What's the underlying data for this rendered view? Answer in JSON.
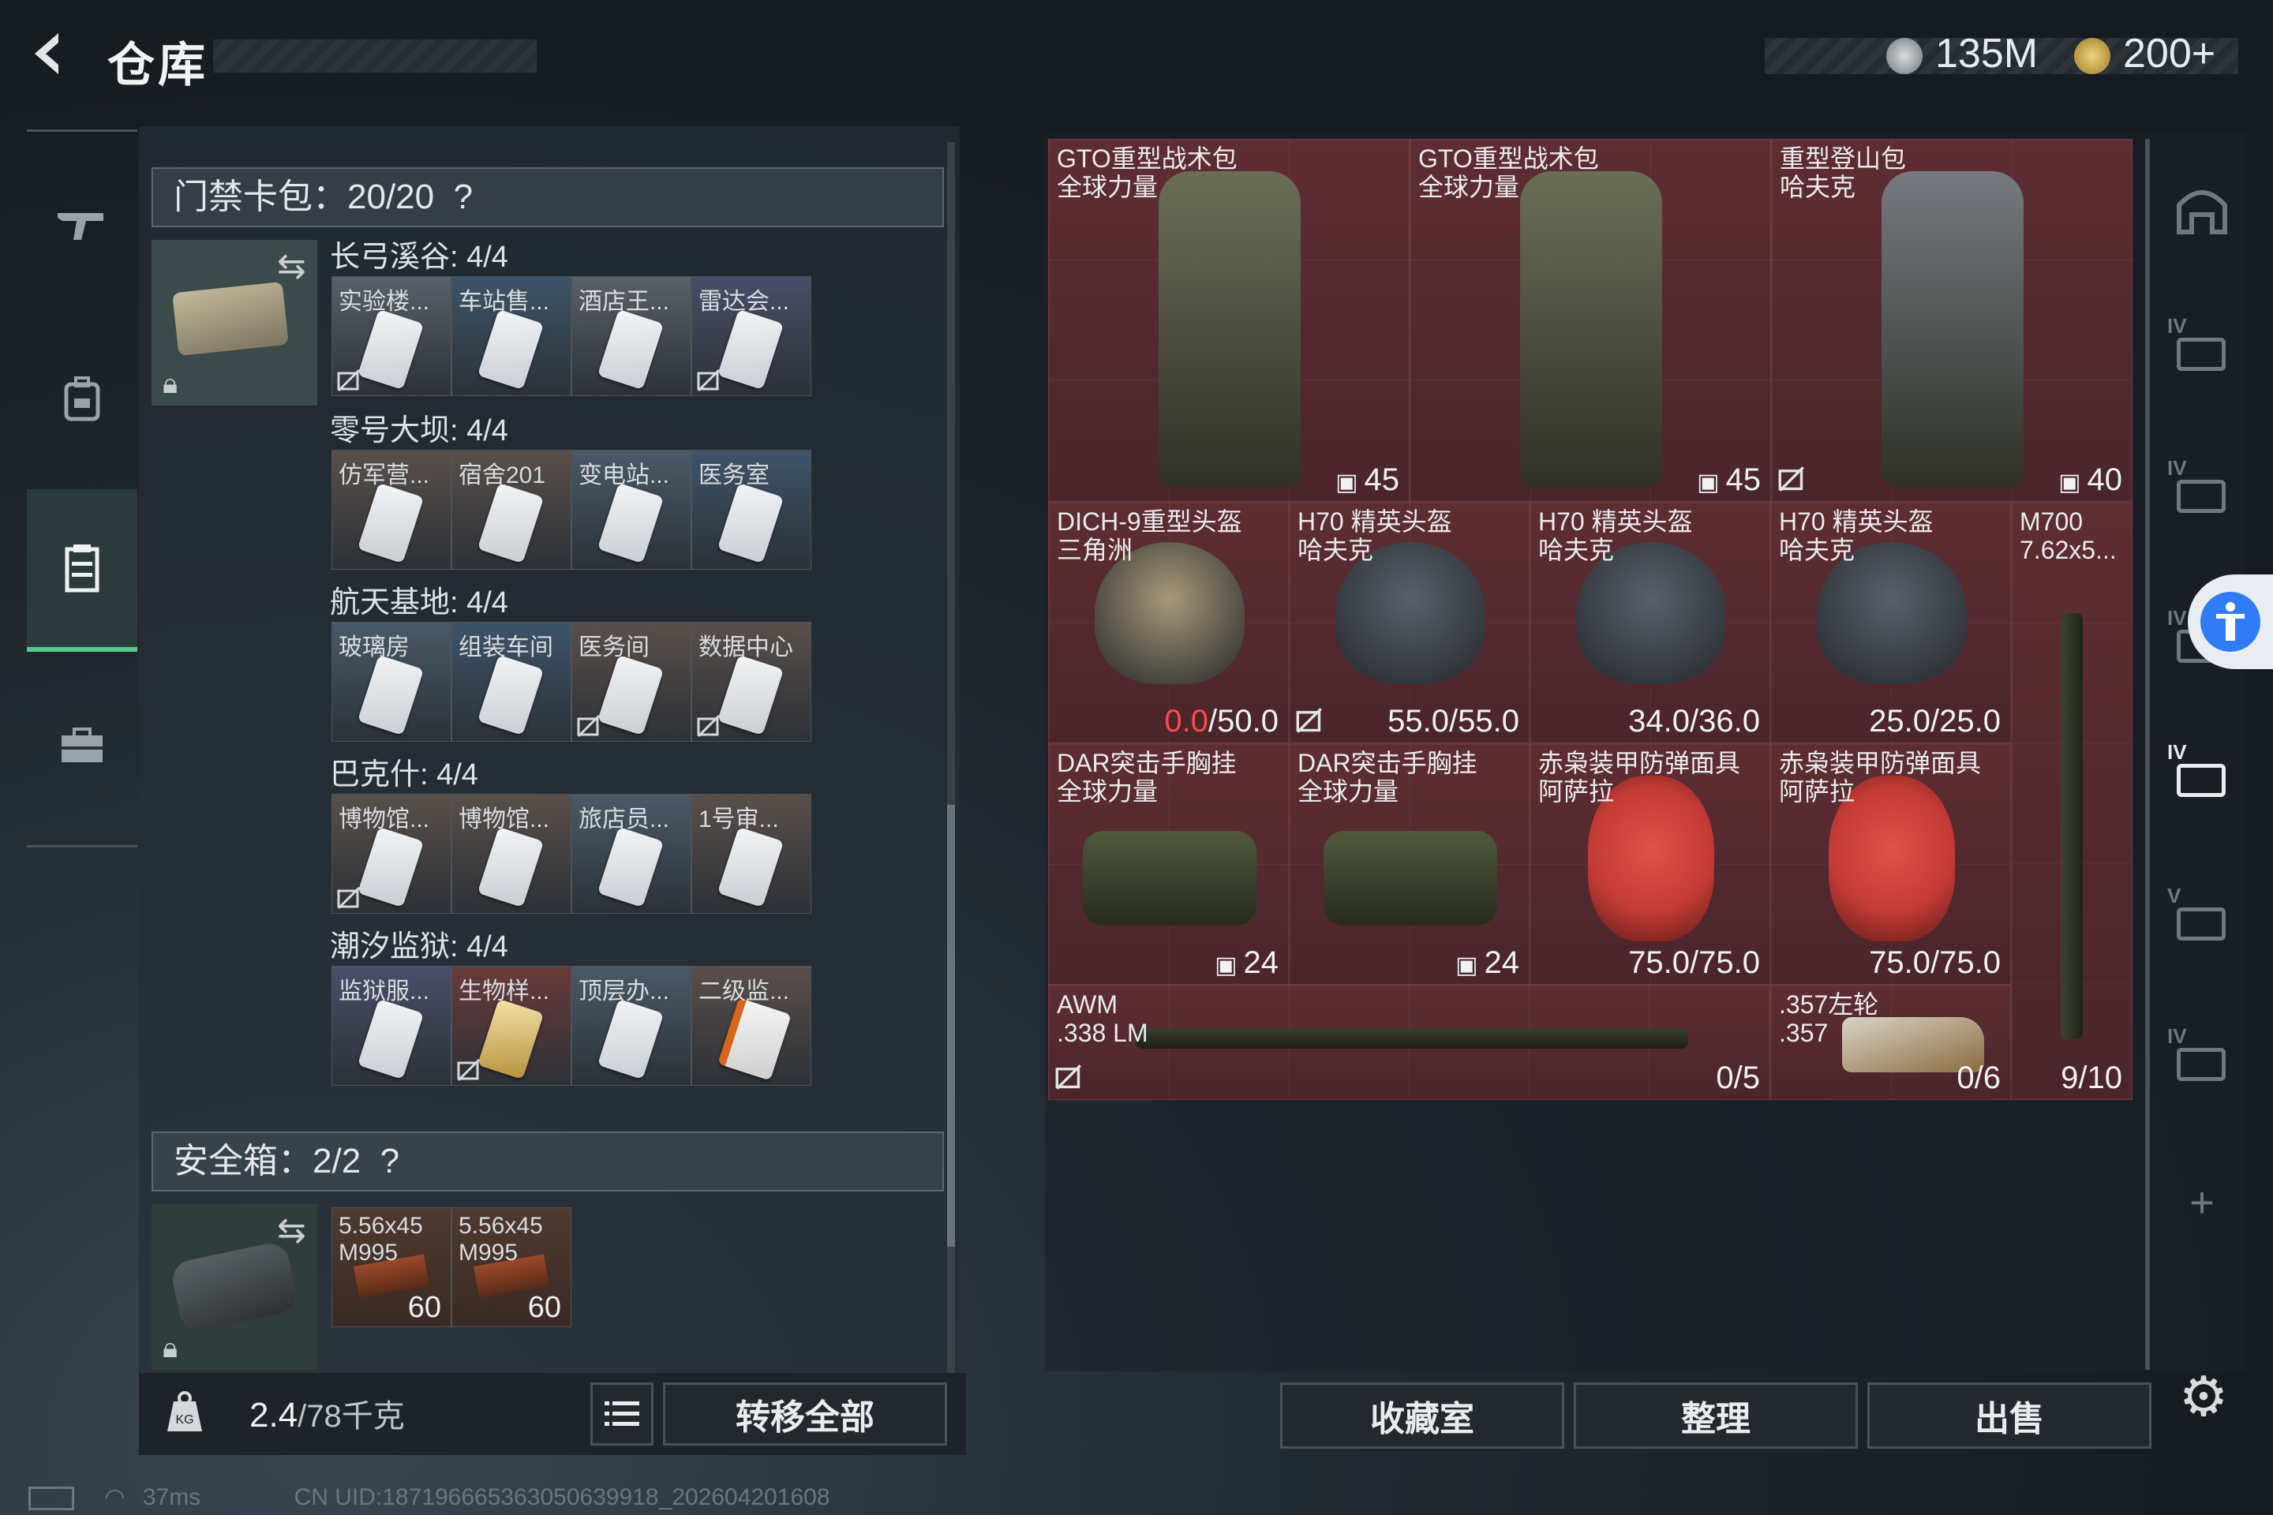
{
  "header": {
    "back_icon": "chevron-left-icon",
    "title": "仓库",
    "currency_1": "135M",
    "currency_2": "200+"
  },
  "left_nav": {
    "items": [
      {
        "name": "weapon-icon"
      },
      {
        "name": "backpack-icon"
      },
      {
        "name": "storage-case-icon",
        "active": true
      },
      {
        "name": "briefcase-icon"
      }
    ]
  },
  "keycard": {
    "header": "门禁卡包：20/20",
    "help": "?",
    "groups": [
      {
        "title": "长弓溪谷: 4/4",
        "items": [
          {
            "label": "实验楼...",
            "locked": true,
            "tint": "#5a6068"
          },
          {
            "label": "车站售...",
            "locked": false,
            "tint": "#3d5568"
          },
          {
            "label": "酒店王...",
            "locked": false,
            "tint": "#5b6068"
          },
          {
            "label": "雷达会...",
            "locked": true,
            "tint": "#4a4e68"
          }
        ]
      },
      {
        "title": "零号大坝: 4/4",
        "items": [
          {
            "label": "仿军营...",
            "locked": false,
            "tint": "#5a4f4a"
          },
          {
            "label": "宿舍201",
            "locked": false,
            "tint": "#5a4f4a"
          },
          {
            "label": "变电站...",
            "locked": false,
            "tint": "#4a5a68"
          },
          {
            "label": "医务室",
            "locked": false,
            "tint": "#3e546a"
          }
        ]
      },
      {
        "title": "航天基地: 4/4",
        "items": [
          {
            "label": "玻璃房",
            "locked": false,
            "tint": "#4a5a68"
          },
          {
            "label": "组装车间",
            "locked": false,
            "tint": "#3e546a"
          },
          {
            "label": "医务间",
            "locked": true,
            "tint": "#5a4f4a"
          },
          {
            "label": "数据中心",
            "locked": true,
            "tint": "#5a4f4a"
          }
        ]
      },
      {
        "title": "巴克什: 4/4",
        "items": [
          {
            "label": "博物馆...",
            "locked": true,
            "tint": "#5a4f4a"
          },
          {
            "label": "博物馆...",
            "locked": false,
            "tint": "#5a4f4a"
          },
          {
            "label": "旅店员...",
            "locked": false,
            "tint": "#4a5a68"
          },
          {
            "label": "1号审...",
            "locked": false,
            "tint": "#5a4f4a"
          }
        ]
      },
      {
        "title": "潮汐监狱: 4/4",
        "items": [
          {
            "label": "监狱服...",
            "locked": false,
            "tint": "#4a4e68"
          },
          {
            "label": "生物样...",
            "locked": true,
            "tint": "#6a3a3a",
            "card": "gold"
          },
          {
            "label": "顶层办...",
            "locked": false,
            "tint": "#4a5a68"
          },
          {
            "label": "二级监...",
            "locked": false,
            "tint": "#5a4f4a",
            "card": "red"
          }
        ]
      }
    ]
  },
  "safebox": {
    "header": "安全箱：2/2",
    "help": "?",
    "items": [
      {
        "label": "5.56x45\nM995",
        "count": "60"
      },
      {
        "label": "5.56x45\nM995",
        "count": "60"
      }
    ]
  },
  "footer_left": {
    "weight_value": "2.4",
    "weight_total": "/78千克",
    "list_icon": "list-icon",
    "transfer_all": "转移全部"
  },
  "grid_items": [
    {
      "name": "GTO重型战术包\n全球力量",
      "stat": "45",
      "stat_icon": "backpack-small-icon",
      "kind": "pack",
      "tint": "#6b6e55"
    },
    {
      "name": "GTO重型战术包\n全球力量",
      "stat": "45",
      "stat_icon": "backpack-small-icon",
      "kind": "pack",
      "tint": "#6b6e55"
    },
    {
      "name": "重型登山包\n哈夫克",
      "stat": "40",
      "stat_icon": "backpack-small-icon",
      "kind": "pack",
      "tint": "#767a80",
      "locked": true
    },
    {
      "name": "DICH-9重型头盔\n三角洲",
      "dur_cur": "0.0",
      "dur_max": "/50.0",
      "kind": "helmet",
      "tint": "#a89878"
    },
    {
      "name": "H70 精英头盔\n哈夫克",
      "dur_cur": "55.0",
      "dur_max": "/55.0",
      "kind": "helmet",
      "tint": "#5a606a",
      "locked": true
    },
    {
      "name": "H70 精英头盔\n哈夫克",
      "dur_cur": "34.0",
      "dur_max": "/36.0",
      "kind": "helmet",
      "tint": "#5a606a"
    },
    {
      "name": "H70 精英头盔\n哈夫克",
      "dur_cur": "25.0",
      "dur_max": "/25.0",
      "kind": "helmet",
      "tint": "#5a606a"
    },
    {
      "name": "M700\n7.62x5...",
      "kind": "rifle-v"
    },
    {
      "name": "DAR突击手胸挂\n全球力量",
      "stat": "24",
      "stat_icon": "vest-small-icon",
      "kind": "rig",
      "tint": "#50583e"
    },
    {
      "name": "DAR突击手胸挂\n全球力量",
      "stat": "24",
      "stat_icon": "vest-small-icon",
      "kind": "rig",
      "tint": "#50583e"
    },
    {
      "name": "赤枭装甲防弹面具\n阿萨拉",
      "dur_cur": "75.0",
      "dur_max": "/75.0",
      "kind": "mask",
      "tint": "#c43b35"
    },
    {
      "name": "赤枭装甲防弹面具\n阿萨拉",
      "dur_cur": "75.0",
      "dur_max": "/75.0",
      "kind": "mask",
      "tint": "#c43b35"
    },
    {
      "name": "AWM\n.338 LM",
      "ammo": "0/5",
      "kind": "awm",
      "locked": true
    },
    {
      "name": ".357左轮\n.357",
      "ammo": "0/6",
      "kind": "revolver"
    },
    {
      "m700_ammo": "9/10"
    }
  ],
  "right_icons": [
    "home-icon",
    "folder-iv-icon",
    "medkit-iv-icon",
    "accessibility-icon",
    "vest-iv-icon",
    "camera-iv-icon",
    "case-iv-icon",
    "plus-icon",
    "gear-icon"
  ],
  "right_labels": {
    "iv": "IV",
    "v": "V"
  },
  "footer_right": {
    "collection": "收藏室",
    "sort": "整理",
    "sell": "出售"
  },
  "status": {
    "ping": "37ms",
    "uid": "CN UID:18719666536305063991​8_202604201608"
  },
  "colors": {
    "accent_green": "#58c98d",
    "danger_red": "#ff4a4a",
    "grid_bg": "#5a2c32"
  }
}
